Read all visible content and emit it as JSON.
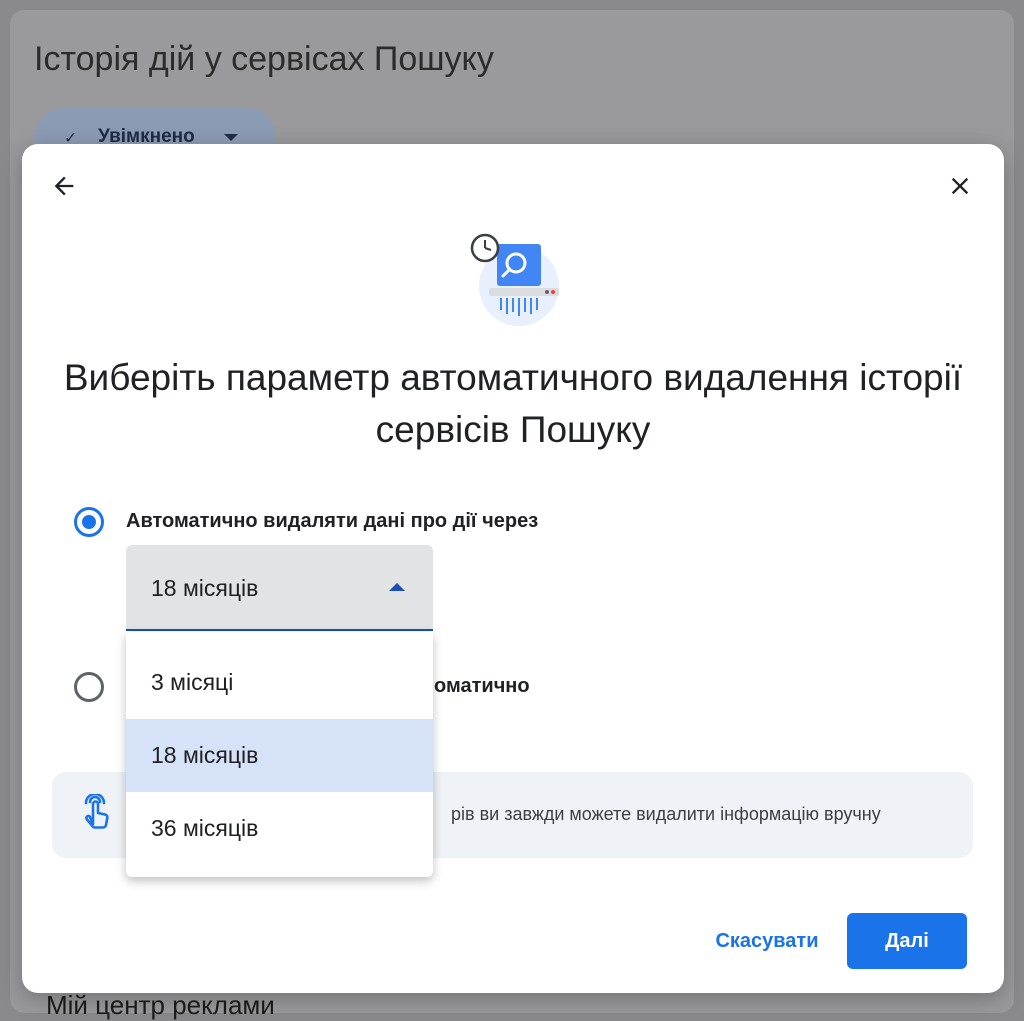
{
  "background": {
    "title": "Історія дій у сервісах Пошуку",
    "status_chip": {
      "label": "Увімкнено",
      "icon": "check-icon"
    },
    "footer_text": "Мій центр реклами"
  },
  "dialog": {
    "back_icon": "arrow-back-icon",
    "close_icon": "close-icon",
    "heading_line1": "Виберіть параметр автоматичного видалення історії",
    "heading_line2": "сервісів Пошуку",
    "options": [
      {
        "label": "Автоматично видаляти дані про дії через",
        "selected": true
      },
      {
        "label_visible_part": "оматично",
        "selected": false
      }
    ],
    "select": {
      "value": "18 місяців",
      "menu_options": [
        "3 місяці",
        "18 місяців",
        "36 місяців"
      ],
      "selected_index": 1
    },
    "info": {
      "icon": "touch-hand-icon",
      "text_visible_part": "рів ви завжди можете видалити інформацію вручну"
    },
    "buttons": {
      "cancel": "Скасувати",
      "next": "Далі"
    }
  },
  "colors": {
    "accent": "#1a73e8",
    "select_underline": "#1a4fb8",
    "menu_selected_bg": "#d5e2f8",
    "info_bg": "#eff2f6"
  }
}
